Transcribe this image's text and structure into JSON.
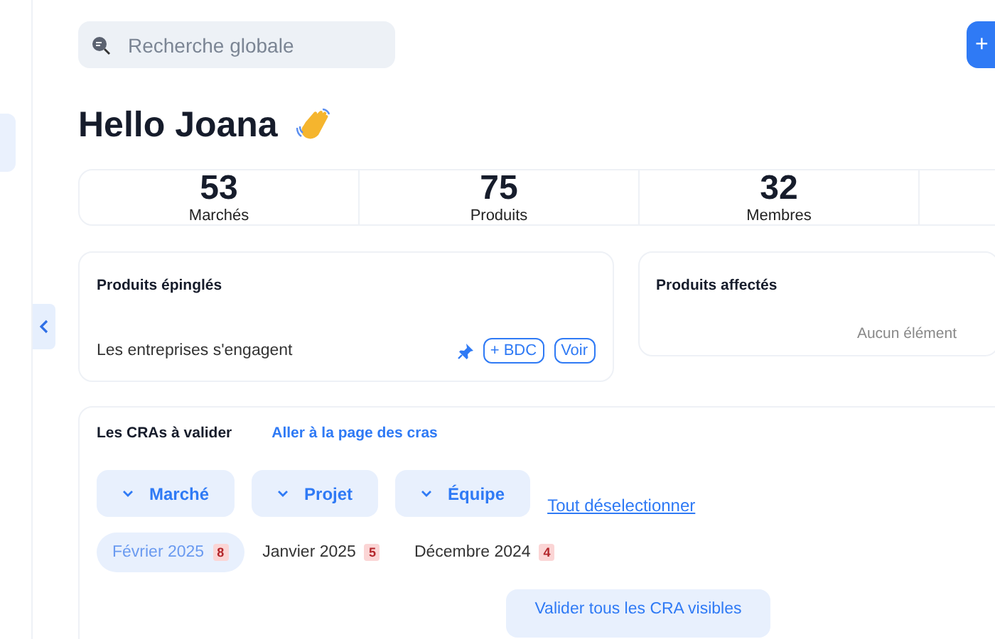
{
  "search": {
    "placeholder": "Recherche globale"
  },
  "add_button": {
    "label": "+"
  },
  "greeting": "Hello Joana",
  "stats": [
    {
      "value": "53",
      "label": "Marchés"
    },
    {
      "value": "75",
      "label": "Produits"
    },
    {
      "value": "32",
      "label": "Membres"
    }
  ],
  "pinned_products": {
    "title": "Produits épinglés",
    "items": [
      {
        "name": "Les entreprises s'engagent",
        "pinned": true,
        "actions": [
          "+ BDC",
          "Voir"
        ]
      }
    ]
  },
  "assigned_products": {
    "title": "Produits affectés",
    "empty_text": "Aucun élément"
  },
  "cra_section": {
    "title": "Les CRAs à valider",
    "link": "Aller à la page des cras",
    "filters": [
      "Marché",
      "Projet",
      "Équipe"
    ],
    "deselect_link": "Tout déselectionner",
    "months": [
      {
        "label": "Février 2025",
        "count": "8",
        "selected": true
      },
      {
        "label": "Janvier 2025",
        "count": "5",
        "selected": false
      },
      {
        "label": "Décembre 2024",
        "count": "4",
        "selected": false
      }
    ],
    "validate_button": "Valider tous les CRA visibles"
  }
}
